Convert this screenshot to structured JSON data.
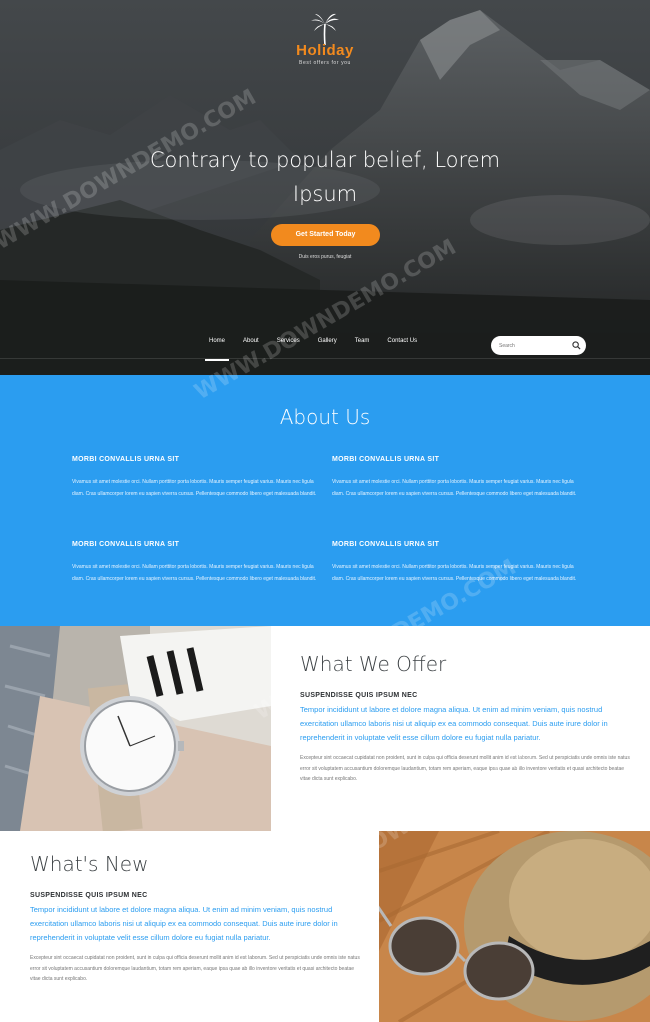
{
  "brand": {
    "name": "Holiday",
    "tagline": "Best offers for you"
  },
  "hero": {
    "title_line1": "Contrary to popular belief, Lorem",
    "title_line2": "Ipsum",
    "cta_label": "Get Started Today",
    "subtext": "Duis eros purus, feugiat"
  },
  "nav": {
    "items": [
      "Home",
      "About",
      "Services",
      "Gallery",
      "Team",
      "Contact Us"
    ],
    "active": "Home"
  },
  "search": {
    "placeholder": "Search"
  },
  "about": {
    "title": "About Us",
    "items": [
      {
        "heading": "MORBI CONVALLIS URNA SIT",
        "text": "Vivamus sit amet molestie orci. Nullam porttitor porta lobortis. Mauris semper feugiat varius. Mauris nec ligula diam. Cras ullamcorper lorem eu sapien viverra cursus. Pellentesque commodo libero eget malesuada blandit."
      },
      {
        "heading": "MORBI CONVALLIS URNA SIT",
        "text": "Vivamus sit amet molestie orci. Nullam porttitor porta lobortis. Mauris semper feugiat varius. Mauris nec ligula diam. Cras ullamcorper lorem eu sapien viverra cursus. Pellentesque commodo libero eget malesuada blandit."
      },
      {
        "heading": "MORBI CONVALLIS URNA SIT",
        "text": "Vivamus sit amet molestie orci. Nullam porttitor porta lobortis. Mauris semper feugiat varius. Mauris nec ligula diam. Cras ullamcorper lorem eu sapien viverra cursus. Pellentesque commodo libero eget malesuada blandit."
      },
      {
        "heading": "MORBI CONVALLIS URNA SIT",
        "text": "Vivamus sit amet molestie orci. Nullam porttitor porta lobortis. Mauris semper feugiat varius. Mauris nec ligula diam. Cras ullamcorper lorem eu sapien viverra cursus. Pellentesque commodo libero eget malesuada blandit."
      }
    ]
  },
  "offer": {
    "title": "What We Offer",
    "subtitle": "SUSPENDISSE QUIS IPSUM NEC",
    "lead": "Tempor incididunt ut labore et dolore magna aliqua. Ut enim ad minim veniam, quis nostrud exercitation ullamco laboris nisi ut aliquip ex ea commodo consequat. Duis aute irure dolor in reprehenderit in voluptate velit esse cillum dolore eu fugiat nulla pariatur.",
    "body": "Excepteur sint occaecat cupidatat non proident, sunt in culpa qui officia deserunt mollit anim id est laborum. Sed ut perspiciatis unde omnis iste natus error sit voluptatem accusantium doloremque laudantium, totam rem aperiam, eaque ipsa quae ab illo inventore veritatis et quasi architecto beatae vitae dicta sunt explicabo."
  },
  "whats_new": {
    "title": "What's New",
    "subtitle": "SUSPENDISSE QUIS IPSUM NEC",
    "lead": "Tempor incididunt ut labore et dolore magna aliqua. Ut enim ad minim veniam, quis nostrud exercitation ullamco laboris nisi ut aliquip ex ea commodo consequat. Duis aute irure dolor in reprehenderit in voluptate velit esse cillum dolore eu fugiat nulla pariatur.",
    "body": "Excepteur sint occaecat cupidatat non proident, sunt in culpa qui officia deserunt mollit anim id est laborum. Sed ut perspiciatis unde omnis iste natus error sit voluptatem accusantium doloremque laudantium, totam rem aperiam, eaque ipsa quae ab illo inventore veritatis et quasi architecto beatae vitae dicta sunt explicabo."
  },
  "watermark": "WWW.DOWNDEMO.COM",
  "colors": {
    "accent": "#f28a1e",
    "blue": "#2b9df0",
    "dark": "#2a2c2e"
  },
  "icons": {
    "logo": "palm-tree-icon",
    "search": "search-icon"
  }
}
